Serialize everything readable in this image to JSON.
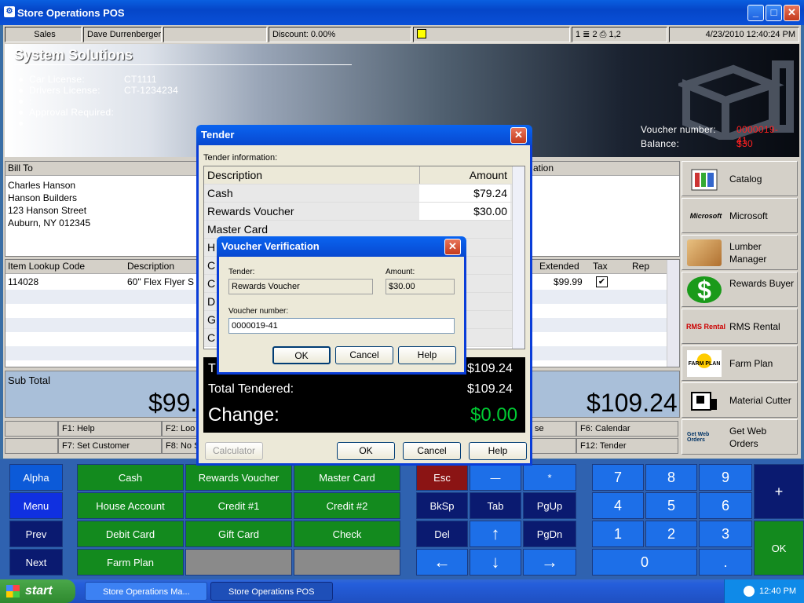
{
  "window": {
    "title": "Store Operations POS"
  },
  "status": {
    "mode": "Sales",
    "cashier": "Dave Durrenberger",
    "blank": "",
    "discount": "Discount: 0.00%",
    "counts": "1 ≣ 2 ⎙ 1,2",
    "datetime": "4/23/2010 12:40:24 PM"
  },
  "banner": {
    "heading": "System Solutions",
    "lines": [
      {
        "label": "Car License:",
        "value": "CT1111"
      },
      {
        "label": "Drivers License:",
        "value": "CT-1234234"
      },
      {
        "label": ":",
        "value": ""
      },
      {
        "label": "Approval Required:",
        "value": ""
      },
      {
        "label": "",
        "value": ""
      }
    ],
    "voucher_label": "Voucher number:",
    "voucher_value": "0000019-41",
    "balance_label": "Balance:",
    "balance_value": "$30"
  },
  "billto": {
    "header": "Bill To",
    "lines": [
      "Charles  Hanson",
      "Hanson Builders",
      "123 Hanson Street",
      "Auburn, NY  012345"
    ],
    "ship_header_partial": "ation"
  },
  "items": {
    "headers": {
      "code": "Item Lookup Code",
      "desc": "Description",
      "extended": "Extended",
      "tax": "Tax",
      "rep": "Rep"
    },
    "rows": [
      {
        "code": "114028",
        "desc": "60\" Flex Flyer S",
        "extended": "$99.99",
        "tax": "✔"
      }
    ]
  },
  "totals": {
    "subtotal_label": "Sub Total",
    "subtotal_partial": "$99.",
    "total_value": "$109.24"
  },
  "fkeys": {
    "f1": "F1: Help",
    "f2": "F2: Loo",
    "f7": "F7: Set Customer",
    "f8": "F8: No S",
    "f6": "F6: Calendar",
    "f12": "F12: Tender",
    "mid1": "se",
    "mid2": ""
  },
  "rightbuttons": [
    {
      "label": "Catalog",
      "icon": "catalog-icon"
    },
    {
      "label": "Microsoft",
      "icon": "microsoft-icon",
      "icontext": "Microsoft"
    },
    {
      "label": "Lumber Manager",
      "icon": "lumber-icon"
    },
    {
      "label": "Rewards Buyer",
      "icon": "dollar-icon",
      "icontext": "$"
    },
    {
      "label": "RMS Rental",
      "icon": "rms-rental-icon",
      "icontext": "RMS Rental"
    },
    {
      "label": "Farm Plan",
      "icon": "farm-plan-icon",
      "icontext": "FARM PLAN"
    },
    {
      "label": "Material Cutter",
      "icon": "material-cutter-icon"
    },
    {
      "label": "Get Web Orders",
      "icon": "web-orders-icon",
      "icontext": "Get Web Orders"
    }
  ],
  "keypad": {
    "left": [
      "Alpha",
      "Menu",
      "Prev",
      "Next"
    ],
    "tenders": [
      "Cash",
      "Rewards Voucher",
      "Master Card",
      "House Account",
      "Credit #1",
      "Credit #2",
      "Debit Card",
      "Gift Card",
      "Check",
      "Farm Plan",
      "",
      ""
    ],
    "esc": "Esc",
    "minus": "—",
    "star": "*",
    "bksp": "BkSp",
    "tab": "Tab",
    "pgup": "PgUp",
    "del": "Del",
    "up": "↑",
    "pgdn": "PgDn",
    "left_arrow": "←",
    "down": "↓",
    "right_arrow": "→",
    "digits": [
      "7",
      "8",
      "9",
      "4",
      "5",
      "6",
      "1",
      "2",
      "3"
    ],
    "zero": "0",
    "dot": ".",
    "plus": "+",
    "ok": "OK"
  },
  "taskbar": {
    "start": "start",
    "tasks": [
      "Store Operations Ma...",
      "Store Operations POS"
    ],
    "clock": "12:40 PM"
  },
  "tender": {
    "title": "Tender",
    "info_label": "Tender information:",
    "col_desc": "Description",
    "col_amount": "Amount",
    "rows": [
      {
        "desc": "Cash",
        "amount": "$79.24"
      },
      {
        "desc": "Rewards Voucher",
        "amount": "$30.00"
      },
      {
        "desc": "Master Card",
        "amount": ""
      },
      {
        "desc": "H",
        "amount": ""
      },
      {
        "desc": "C",
        "amount": ""
      },
      {
        "desc": "C",
        "amount": ""
      },
      {
        "desc": "D",
        "amount": ""
      },
      {
        "desc": "G",
        "amount": ""
      },
      {
        "desc": "C",
        "amount": ""
      }
    ],
    "total_partial": "T",
    "total_value": "$109.24",
    "tendered_label": "Total Tendered:",
    "tendered_value": "$109.24",
    "change_label": "Change:",
    "change_value": "$0.00",
    "calculator": "Calculator",
    "ok": "OK",
    "cancel": "Cancel",
    "help": "Help"
  },
  "voucher": {
    "title": "Voucher Verification",
    "tender_label": "Tender:",
    "tender_value": "Rewards Voucher",
    "amount_label": "Amount:",
    "amount_value": "$30.00",
    "number_label": "Voucher number:",
    "number_value": "0000019-41",
    "ok": "OK",
    "cancel": "Cancel",
    "help": "Help"
  },
  "colors": {
    "keypad_green": "#138a1e",
    "change_green": "#00cc33",
    "voucher_red": "#ff2020"
  }
}
